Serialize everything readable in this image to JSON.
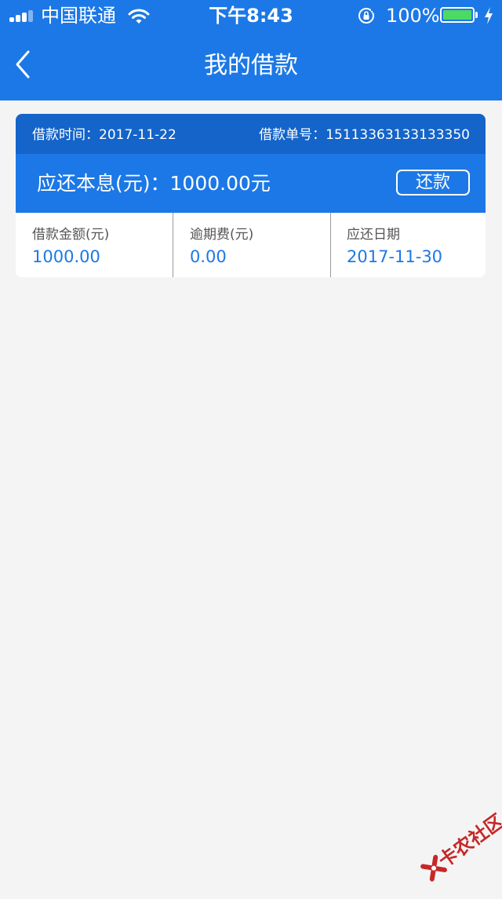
{
  "status_bar": {
    "carrier": "中国联通",
    "time": "下午8:43",
    "battery_percent": "100%",
    "battery_level": 1.0,
    "signal_bars": 3,
    "signal_bars_total": 4
  },
  "nav": {
    "title": "我的借款"
  },
  "loan": {
    "loan_time": "借款时间：2017-11-22",
    "loan_number": "借款单号：15113363133133350",
    "amount_due": "应还本息(元)：1000.00元",
    "repay_label": "还款",
    "details": [
      {
        "label": "借款金额(元)",
        "value": "1000.00"
      },
      {
        "label": "逾期费(元)",
        "value": "0.00"
      },
      {
        "label": "应还日期",
        "value": "2017-11-30"
      }
    ]
  },
  "watermark": {
    "text": "卡农社区"
  },
  "colors": {
    "primary": "#1c78e6",
    "header_dark": "#1464c9",
    "background": "#f4f4f4",
    "value_text": "#1c78e6",
    "battery": "#4cd964",
    "watermark": "#c62828"
  }
}
